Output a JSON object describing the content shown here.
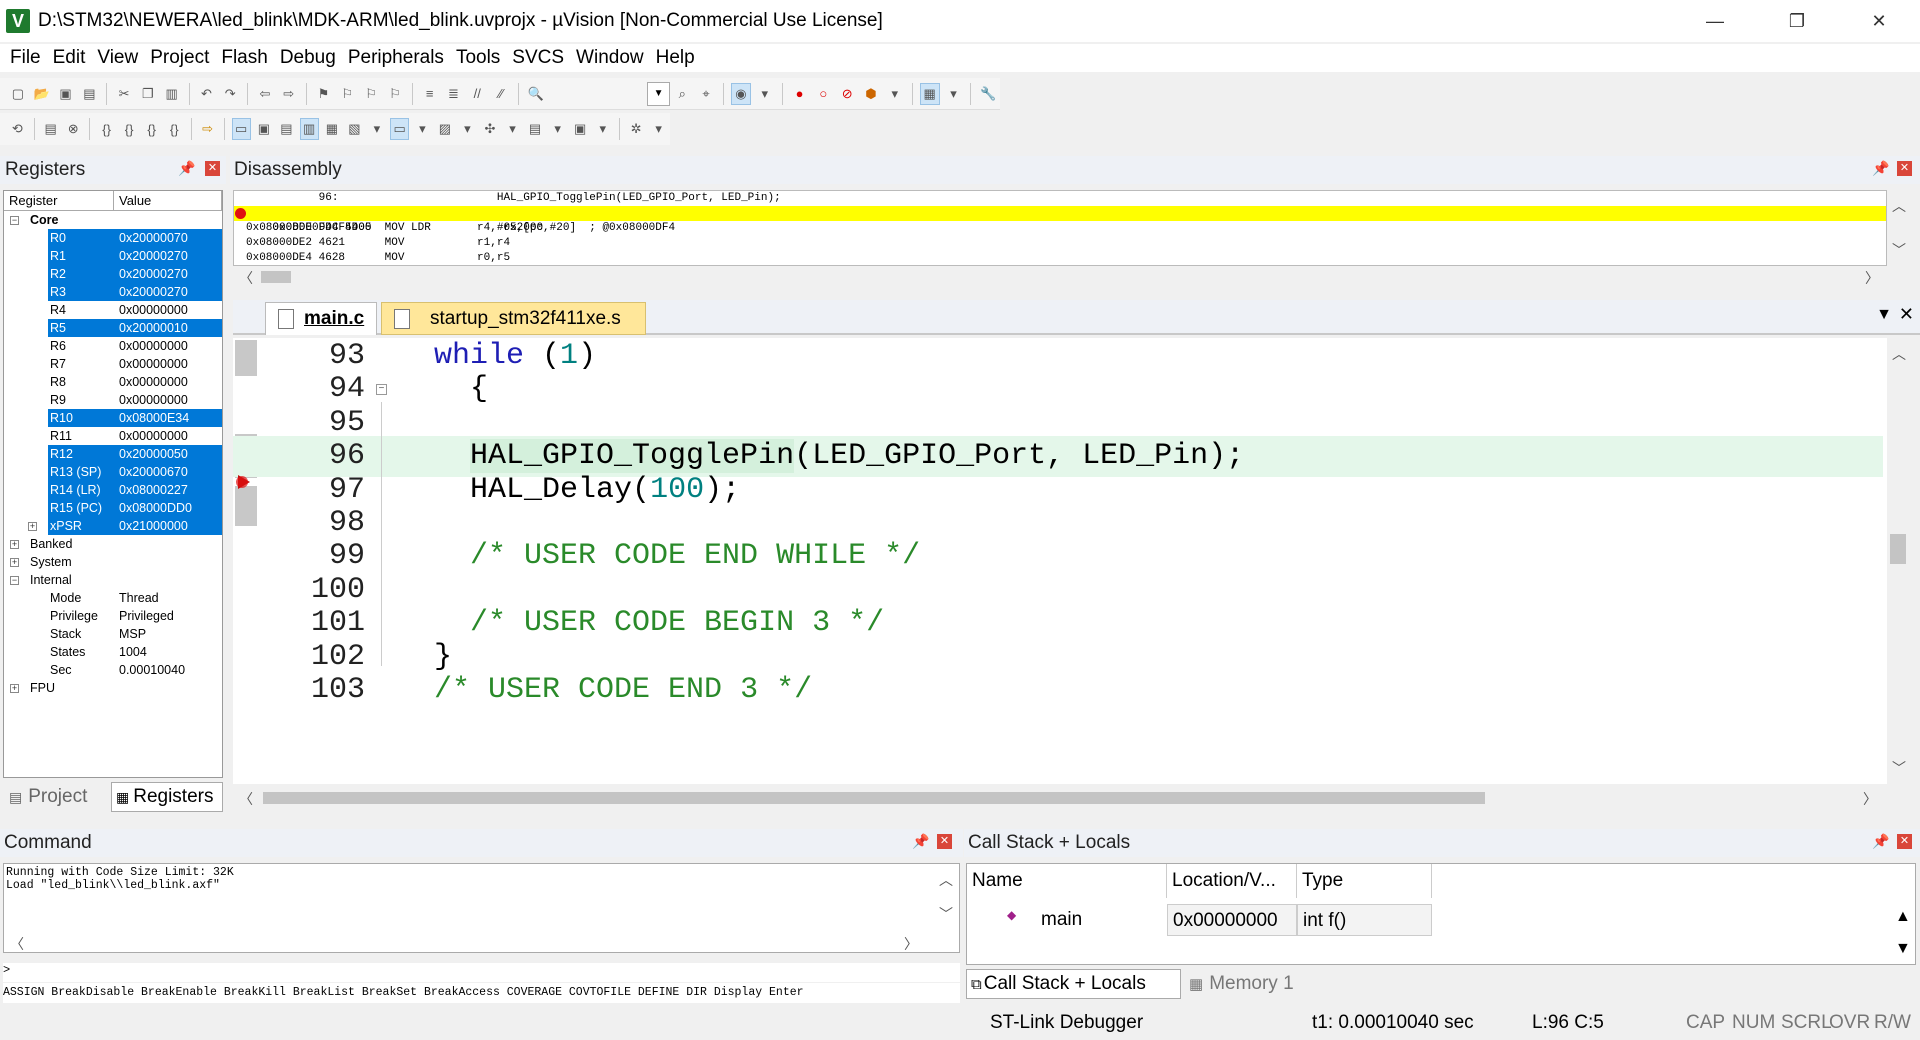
{
  "window": {
    "title": "D:\\STM32\\NEWERA\\led_blink\\MDK-ARM\\led_blink.uvprojx - µVision  [Non-Commercial Use License]",
    "icon_letter": "V",
    "minimize": "—",
    "restore": "❐",
    "close": "✕"
  },
  "menu": [
    "File",
    "Edit",
    "View",
    "Project",
    "Flash",
    "Debug",
    "Peripherals",
    "Tools",
    "SVCS",
    "Window",
    "Help"
  ],
  "registers": {
    "title": "Registers",
    "col_register": "Register",
    "col_value": "Value",
    "core_label": "Core",
    "rows": [
      {
        "name": "R0",
        "value": "0x20000070",
        "sel": true
      },
      {
        "name": "R1",
        "value": "0x20000270",
        "sel": true
      },
      {
        "name": "R2",
        "value": "0x20000270",
        "sel": true
      },
      {
        "name": "R3",
        "value": "0x20000270",
        "sel": true
      },
      {
        "name": "R4",
        "value": "0x00000000",
        "sel": false
      },
      {
        "name": "R5",
        "value": "0x20000010",
        "sel": true
      },
      {
        "name": "R6",
        "value": "0x00000000",
        "sel": false
      },
      {
        "name": "R7",
        "value": "0x00000000",
        "sel": false
      },
      {
        "name": "R8",
        "value": "0x00000000",
        "sel": false
      },
      {
        "name": "R9",
        "value": "0x00000000",
        "sel": false
      },
      {
        "name": "R10",
        "value": "0x08000E34",
        "sel": true
      },
      {
        "name": "R11",
        "value": "0x00000000",
        "sel": false
      },
      {
        "name": "R12",
        "value": "0x20000050",
        "sel": true
      },
      {
        "name": "R13 (SP)",
        "value": "0x20000670",
        "sel": true
      },
      {
        "name": "R14 (LR)",
        "value": "0x08000227",
        "sel": true
      },
      {
        "name": "R15 (PC)",
        "value": "0x08000DD0",
        "sel": true
      },
      {
        "name": "xPSR",
        "value": "0x21000000",
        "sel": true
      }
    ],
    "groups": [
      "Banked",
      "System",
      "Internal"
    ],
    "internal": [
      {
        "name": "Mode",
        "value": "Thread"
      },
      {
        "name": "Privilege",
        "value": "Privileged"
      },
      {
        "name": "Stack",
        "value": "MSP"
      },
      {
        "name": "States",
        "value": "1004"
      },
      {
        "name": "Sec",
        "value": "0.00010040"
      }
    ],
    "fpu_label": "FPU",
    "tab_project": "Project",
    "tab_registers": "Registers"
  },
  "disassembly": {
    "title": "Disassembly",
    "lines": [
      "           96:                        HAL_GPIO_TogglePin(LED_GPIO_Port, LED_Pin);",
      "0x08000DDC 4D05      LDR           r5,[pc,#20]  ; @0x08000DF4",
      "0x08000DDE F44F5400  MOV           r4,#0x2000",
      "0x08000DE2 4621      MOV           r1,r4",
      "0x08000DE4 4628      MOV           r0,r5"
    ]
  },
  "editor": {
    "tab_main": "main.c",
    "tab_startup": "startup_stm32f411xe.s",
    "lines": [
      {
        "n": "93",
        "kw": "while",
        "rest": " (",
        "num": "1",
        "end": ")"
      },
      {
        "n": "94",
        "text": "  {"
      },
      {
        "n": "95",
        "text": ""
      },
      {
        "n": "96",
        "fn": "HAL_GPIO_TogglePin",
        "rest": "(LED_GPIO_Port, LED_Pin);"
      },
      {
        "n": "97",
        "fn": "HAL_Delay",
        "num": "100",
        "end": ");"
      },
      {
        "n": "98",
        "text": ""
      },
      {
        "n": "99",
        "cmt": "/* USER CODE END WHILE */"
      },
      {
        "n": "100",
        "text": ""
      },
      {
        "n": "101",
        "cmt": "/* USER CODE BEGIN 3 */"
      },
      {
        "n": "102",
        "text": "}"
      },
      {
        "n": "103",
        "cmt": "/* USER CODE END 3 */"
      }
    ]
  },
  "command": {
    "title": "Command",
    "output1": "Running with Code Size Limit: 32K",
    "output2": "Load \"led_blink\\\\led_blink.axf\"",
    "prompt": ">",
    "help": "ASSIGN BreakDisable BreakEnable BreakKill BreakList BreakSet BreakAccess COVERAGE COVTOFILE DEFINE DIR Display Enter"
  },
  "callstack": {
    "title": "Call Stack + Locals",
    "col_name": "Name",
    "col_location": "Location/V...",
    "col_type": "Type",
    "row_name": "main",
    "row_location": "0x00000000",
    "row_type": "int f()",
    "tab_callstack": "Call Stack + Locals",
    "tab_memory": "Memory 1"
  },
  "status": {
    "debugger": "ST-Link Debugger",
    "time": "t1: 0.00010040 sec",
    "pos": "L:96 C:5",
    "cap": "CAP",
    "num": "NUM",
    "scrl": "SCRL",
    "ovr": "OVR",
    "rw": "R/W"
  },
  "colors": {
    "selection": "#0078d7",
    "current_line_disasm": "#ffff00",
    "current_line_editor": "#e4f7ea",
    "keyword": "#1e1eb4",
    "comment": "#2a8a2a",
    "number": "#008080",
    "breakpoint": "#e01010",
    "close_button": "#d9463a"
  }
}
